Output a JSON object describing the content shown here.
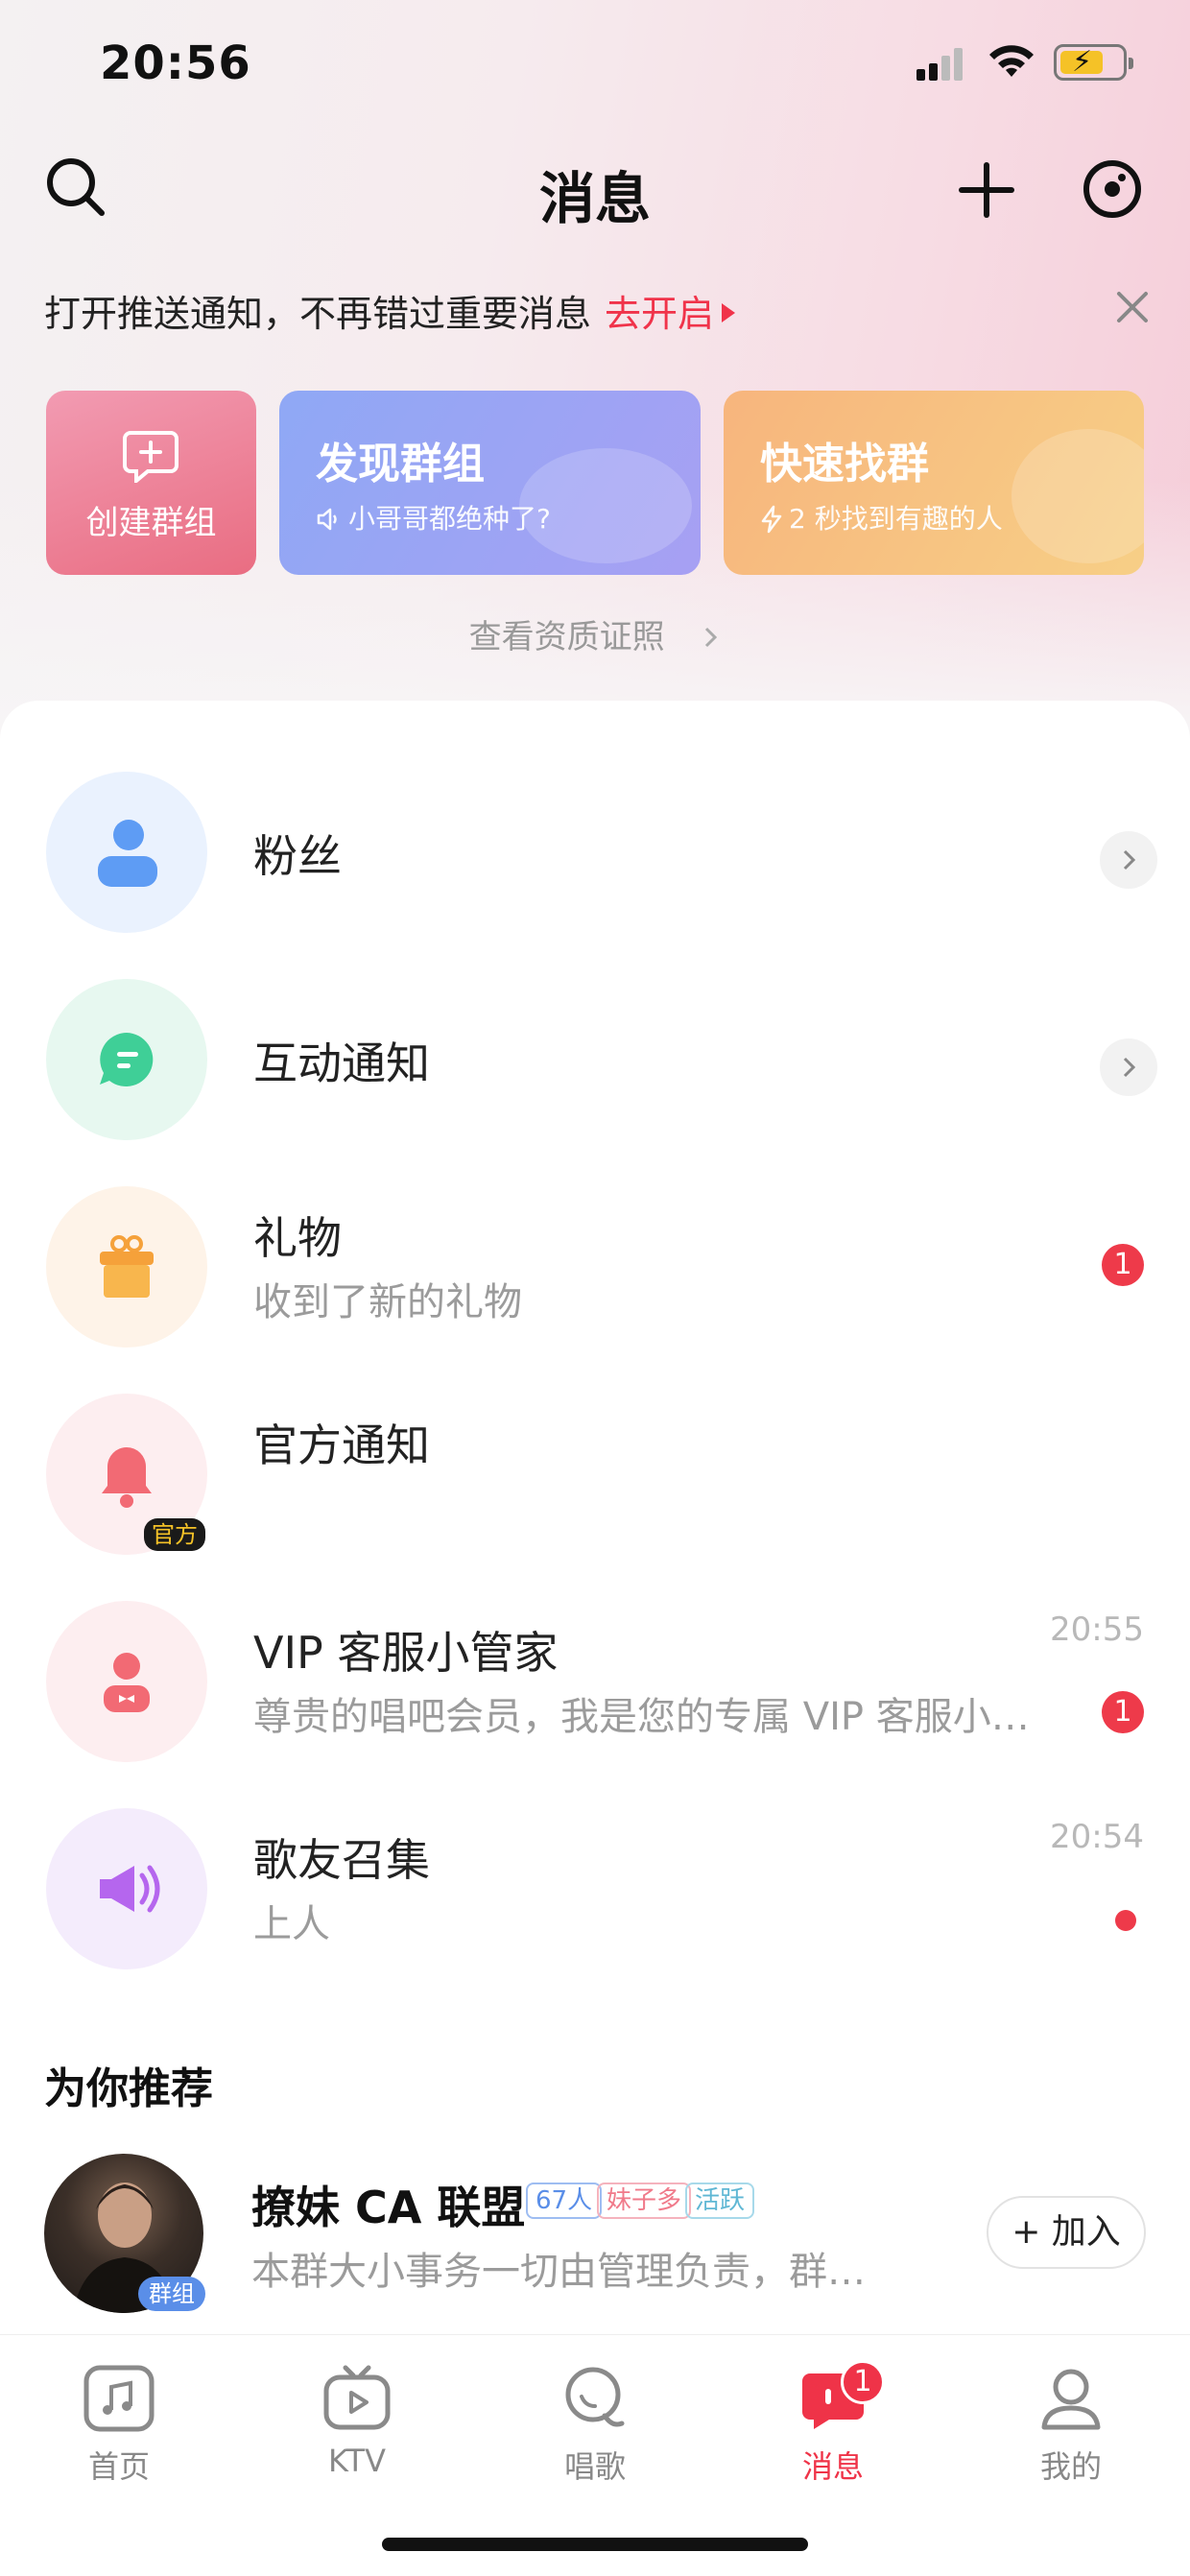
{
  "status_bar": {
    "time": "20:56"
  },
  "header": {
    "title": "消息"
  },
  "notice": {
    "text": "打开推送通知，不再错过重要消息",
    "link": "去开启"
  },
  "cards": {
    "create": {
      "title": "创建群组"
    },
    "discover": {
      "title": "发现群组",
      "subtitle": "小哥哥都绝种了?"
    },
    "quick": {
      "title": "快速找群",
      "subtitle": "2 秒找到有趣的人"
    }
  },
  "cert_link": "查看资质证照",
  "messages": [
    {
      "name": "粉丝",
      "preview": "",
      "time": "",
      "badge": ""
    },
    {
      "name": "互动通知",
      "preview": "",
      "time": "",
      "badge": ""
    },
    {
      "name": "礼物",
      "preview": "收到了新的礼物",
      "time": "",
      "badge": "1"
    },
    {
      "name": "官方通知",
      "preview": "",
      "time": "",
      "badge": "",
      "tag": "官方"
    },
    {
      "name": "VIP 客服小管家",
      "preview": "尊贵的唱吧会员，我是您的专属 VIP 客服小…",
      "time": "20:55",
      "badge": "1"
    },
    {
      "name": "歌友召集",
      "preview": "上人",
      "time": "20:54",
      "badge": ""
    }
  ],
  "recommend": {
    "title": "为你推荐",
    "group": {
      "name": "撩妹 CA 联盟",
      "tags": [
        "67人",
        "妹子多",
        "活跃"
      ],
      "desc": "本群大小事务一切由管理负责，群…",
      "join_label": "+ 加入",
      "avatar_tag": "群组"
    }
  },
  "tabbar": {
    "items": [
      {
        "label": "首页"
      },
      {
        "label": "KTV"
      },
      {
        "label": "唱歌"
      },
      {
        "label": "消息",
        "badge": "1"
      },
      {
        "label": "我的"
      }
    ]
  },
  "colors": {
    "accent": "#ef3348",
    "text": "#222222",
    "muted": "#9b9b9b"
  }
}
